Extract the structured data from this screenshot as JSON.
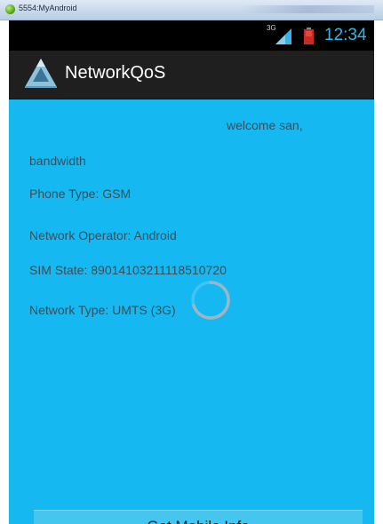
{
  "emulator": {
    "title": "5554:MyAndroid"
  },
  "status_bar": {
    "network_type": "3G",
    "time": "12:34",
    "signal_icon": "signal-bars-icon",
    "battery_icon": "battery-low-icon",
    "clock_color": "#33b5e5"
  },
  "action_bar": {
    "title": "NetworkQoS",
    "icon": "app-triangle-icon"
  },
  "content": {
    "background_color": "#16b8f2",
    "welcome": "welcome san,",
    "bandwidth": "bandwidth",
    "phone_type": "Phone Type: GSM",
    "network_operator": "Network Operator: Android",
    "sim_state": "SIM State: 89014103211118510720",
    "network_type": "Network Type: UMTS (3G)",
    "loading_icon": "loading-spinner-icon"
  },
  "button": {
    "label": "Get Mobile Info"
  }
}
